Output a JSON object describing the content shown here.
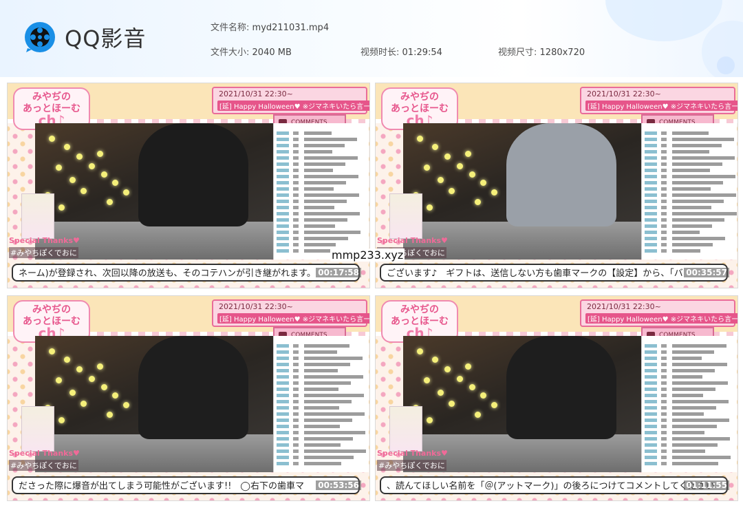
{
  "app": {
    "name": "QQ影音"
  },
  "file_info": {
    "name_label": "文件名称:",
    "name_value": "myd211031.mp4",
    "size_label": "文件大小:",
    "size_value": "2040 MB",
    "duration_label": "视频时长:",
    "duration_value": "01:29:54",
    "dims_label": "视频尺寸:",
    "dims_value": "1280x720"
  },
  "watermark": "mmp233.xyz",
  "stream": {
    "date": "2021/10/31 22:30~",
    "title": "[延] Happy Halloween♥ ※ジマネキいたら言ーいちま",
    "comments_label": "COMMENTS",
    "special": "Special Thanks♥",
    "hashtag": "#みやちぽくでおに",
    "channel_line1": "みやぢの",
    "channel_line2": "あっとほーむ",
    "channel_line3": "ch♪"
  },
  "thumbnails": [
    {
      "subtitle": "ネーム)が登録され、次回以降の放送も、そのコテハンが引き継がれます。",
      "timestamp": "00:17:58"
    },
    {
      "subtitle": "ございます♪　ギフトは、送信しない方も歯車マークの【設定】から、「バ",
      "timestamp": "00:35:57"
    },
    {
      "subtitle": "ださった際に爆音が出てしまう可能性がございます!!　◯右下の歯車マ",
      "timestamp": "00:53:56"
    },
    {
      "subtitle": "、読んてほしい名前を「＠(アットマーク)」の後ろにつけてコメントしてください",
      "timestamp": "01:11:55"
    }
  ],
  "colors": {
    "accent": "#e7578d",
    "header_bg": "#eaf4ff",
    "logo_blue": "#1a8fe6"
  }
}
